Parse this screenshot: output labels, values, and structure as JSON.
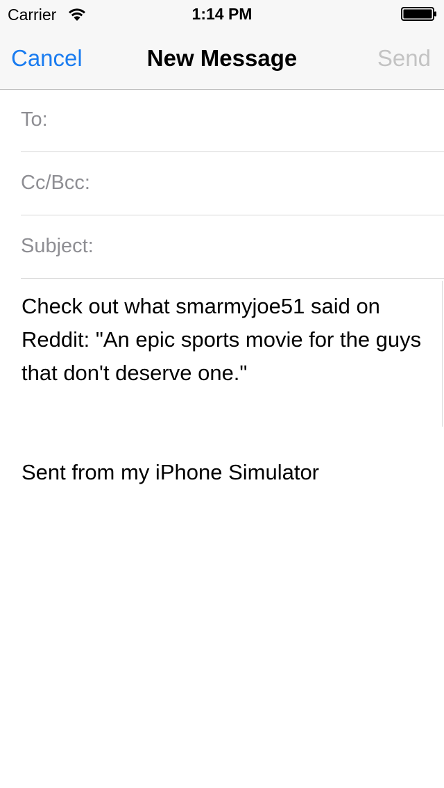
{
  "status_bar": {
    "carrier": "Carrier",
    "time": "1:14 PM",
    "icons": [
      "wifi-icon",
      "battery-icon"
    ]
  },
  "nav": {
    "cancel_label": "Cancel",
    "title": "New Message",
    "send_label": "Send",
    "colors": {
      "accent": "#1a7cf0",
      "disabled": "#c3c3c3"
    }
  },
  "fields": {
    "to_label": "To:",
    "to_value": "",
    "ccbcc_label": "Cc/Bcc:",
    "ccbcc_value": "",
    "subject_label": "Subject:",
    "subject_value": ""
  },
  "body": {
    "text": "Check out what smarmyjoe51 said on Reddit: \"An epic sports movie for the guys that don't deserve one.\"",
    "signature": "Sent from my iPhone Simulator"
  }
}
